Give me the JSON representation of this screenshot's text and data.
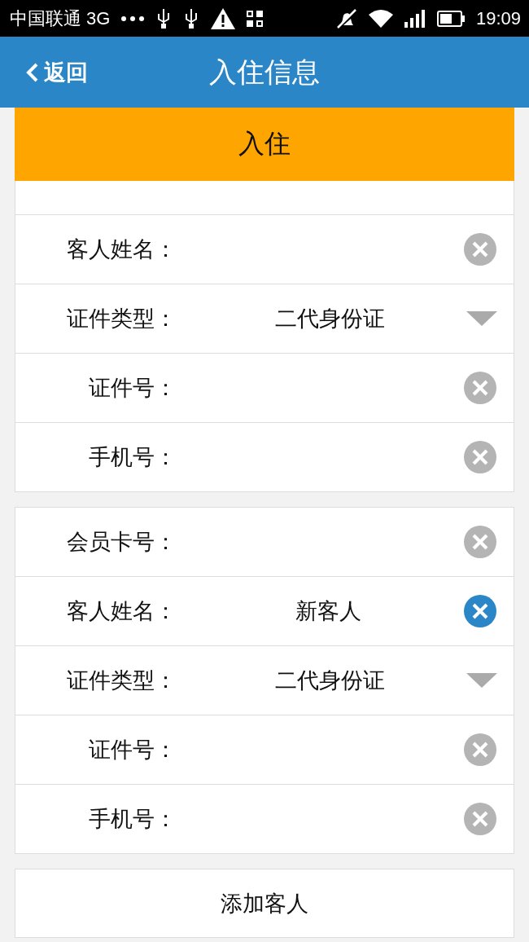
{
  "status_bar": {
    "carrier": "中国联通 3G",
    "time": "19:09"
  },
  "header": {
    "back": "返回",
    "title": "入住信息"
  },
  "banner": {
    "label": "入住"
  },
  "guests": [
    {
      "fields": [
        {
          "kind": "input",
          "label": "客人姓名：",
          "focused": false
        },
        {
          "kind": "select",
          "label": "证件类型：",
          "value": "二代身份证"
        },
        {
          "kind": "input",
          "label": "证件号：",
          "focused": false
        },
        {
          "kind": "input",
          "label": "手机号：",
          "focused": false
        }
      ]
    },
    {
      "fields": [
        {
          "kind": "input",
          "label": "会员卡号：",
          "focused": false
        },
        {
          "kind": "input",
          "label": "客人姓名：",
          "value": "新客人",
          "focused": true
        },
        {
          "kind": "select",
          "label": "证件类型：",
          "value": "二代身份证"
        },
        {
          "kind": "input",
          "label": "证件号：",
          "focused": false
        },
        {
          "kind": "input",
          "label": "手机号：",
          "focused": false
        }
      ]
    }
  ],
  "add_button": {
    "label": "添加客人"
  }
}
